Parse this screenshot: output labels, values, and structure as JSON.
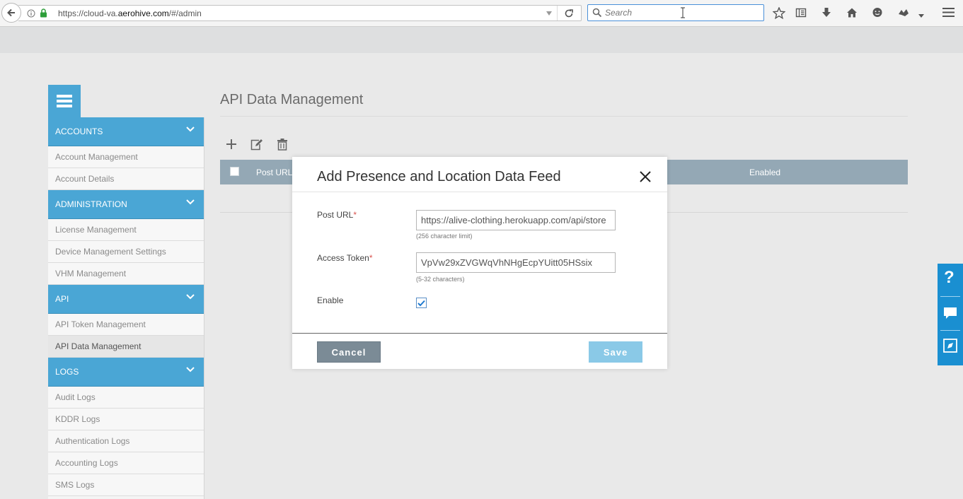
{
  "browser": {
    "url_prefix": "https://cloud-va.",
    "url_domain": "aerohive.com",
    "url_suffix": "/#/admin",
    "search_placeholder": "Search"
  },
  "sidebar": {
    "sections": [
      {
        "label": "ACCOUNTS",
        "items": [
          "Account Management",
          "Account Details"
        ]
      },
      {
        "label": "ADMINISTRATION",
        "items": [
          "License Management",
          "Device Management Settings",
          "VHM Management"
        ]
      },
      {
        "label": "API",
        "items": [
          "API Token Management",
          "API Data Management"
        ]
      },
      {
        "label": "LOGS",
        "items": [
          "Audit Logs",
          "KDDR Logs",
          "Authentication Logs",
          "Accounting Logs",
          "SMS Logs"
        ]
      }
    ],
    "active_item": "API Data Management"
  },
  "main": {
    "title": "API Data Management",
    "table": {
      "col_post_url": "Post URL",
      "col_enabled": "Enabled"
    }
  },
  "modal": {
    "title": "Add Presence and Location Data Feed",
    "post_url": {
      "label": "Post URL",
      "required_mark": "*",
      "value": "https://alive-clothing.herokuapp.com/api/store",
      "hint": "(256 character limit)"
    },
    "access_token": {
      "label": "Access Token",
      "required_mark": "*",
      "value": "VpVw29xZVGWqVhNHgEcpYUitt05HSsix",
      "hint": "(5-32 characters)"
    },
    "enable": {
      "label": "Enable",
      "checked": true
    },
    "cancel_label": "Cancel",
    "save_label": "Save"
  },
  "help_tab": {
    "question_label": "?"
  }
}
